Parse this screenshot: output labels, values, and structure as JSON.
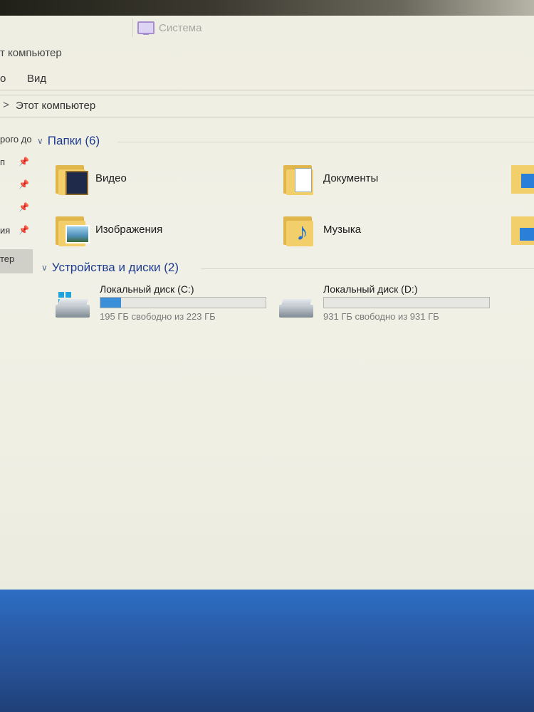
{
  "window": {
    "tab_title": "Система",
    "title": "т компьютер"
  },
  "ribbon": {
    "tab_1": "о",
    "tab_2": "Вид"
  },
  "address": {
    "separator": ">",
    "crumb": "Этот компьютер"
  },
  "nav": {
    "items": [
      {
        "label": "рого до",
        "pinned": false
      },
      {
        "label": "п",
        "pinned": true
      },
      {
        "label": "",
        "pinned": true
      },
      {
        "label": "",
        "pinned": true
      },
      {
        "label": "ия",
        "pinned": true
      },
      {
        "label": "тер",
        "pinned": false,
        "selected": true
      }
    ]
  },
  "folders": {
    "header": "Папки (6)",
    "items": [
      {
        "label": "Видео",
        "icon": "video-folder-icon"
      },
      {
        "label": "Документы",
        "icon": "documents-folder-icon"
      },
      {
        "label": "Изображения",
        "icon": "pictures-folder-icon"
      },
      {
        "label": "Музыка",
        "icon": "music-folder-icon"
      }
    ]
  },
  "drives": {
    "header": "Устройства и диски (2)",
    "items": [
      {
        "name": "Локальный диск (C:)",
        "free_text": "195 ГБ свободно из 223 ГБ",
        "used_fraction": 0.126,
        "icon": "system-drive-icon"
      },
      {
        "name": "Локальный диск (D:)",
        "free_text": "931 ГБ свободно из 931 ГБ",
        "used_fraction": 0.0,
        "icon": "drive-icon"
      }
    ]
  },
  "colors": {
    "accent": "#1e3d8f",
    "usage_bar": "#3b8ed8",
    "folder": "#f2cf6b",
    "taskbar": "#2a5ca8"
  }
}
